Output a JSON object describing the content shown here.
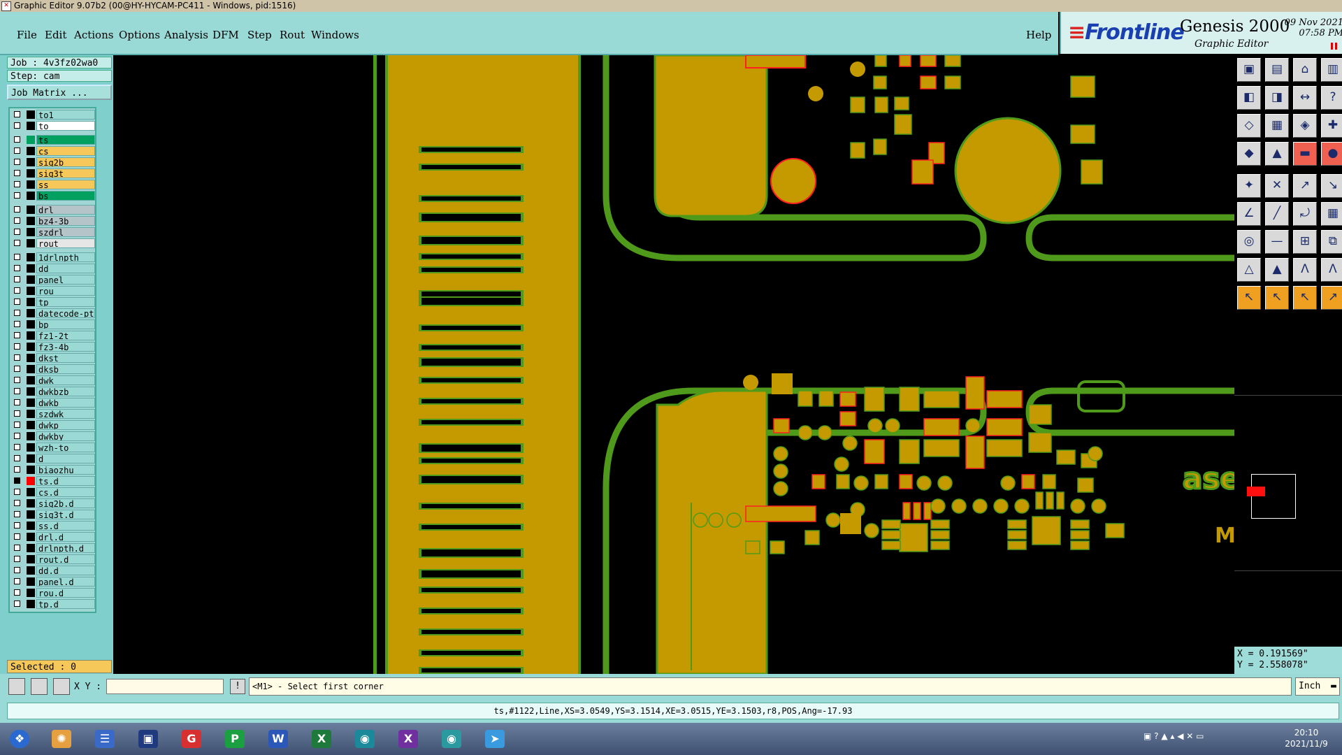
{
  "titlebar": {
    "title": "Graphic Editor 9.07b2 (00@HY-HYCAM-PC411 - Windows, pid:1516)"
  },
  "menu": {
    "items": [
      "File",
      "Edit",
      "Actions",
      "Options",
      "Analysis",
      "DFM",
      "Step",
      "Rout",
      "Windows"
    ],
    "help": "Help"
  },
  "brand": {
    "logo": "Frontline",
    "product": "Genesis 2000",
    "subtitle": "Graphic Editor",
    "date": "09 Nov 2021",
    "time": "07:58 PM"
  },
  "job": {
    "job_label": "Job : 4v3fz02wa0",
    "step_label": "Step: cam",
    "matrix_button": "Job Matrix ..."
  },
  "layers": [
    {
      "name": "to1",
      "color": "#9bd9d4",
      "sw": ""
    },
    {
      "name": "to",
      "color": "#ffffff",
      "sw": ""
    },
    {
      "name": "ts",
      "color": "#00a060",
      "sw": "#00a060",
      "active": true
    },
    {
      "name": "cs",
      "color": "#f6c85a",
      "sw": ""
    },
    {
      "name": "sig2b",
      "color": "#f6c85a",
      "sw": ""
    },
    {
      "name": "sig3t",
      "color": "#f6c85a",
      "sw": ""
    },
    {
      "name": "ss",
      "color": "#f6c85a",
      "sw": ""
    },
    {
      "name": "bs",
      "color": "#00a060",
      "sw": ""
    },
    {
      "name": "drl",
      "color": "#b4c4c8",
      "sw": ""
    },
    {
      "name": "bz4-3b",
      "color": "#b4c4c8",
      "sw": ""
    },
    {
      "name": "szdrl",
      "color": "#b4c4c8",
      "sw": ""
    },
    {
      "name": "rout",
      "color": "#e6e6e6",
      "sw": ""
    },
    {
      "name": "1drlnpth",
      "color": "#9bd9d4",
      "sw": ""
    },
    {
      "name": "dd",
      "color": "#9bd9d4",
      "sw": ""
    },
    {
      "name": "panel",
      "color": "#9bd9d4",
      "sw": ""
    },
    {
      "name": "rou",
      "color": "#9bd9d4",
      "sw": ""
    },
    {
      "name": "tp",
      "color": "#9bd9d4",
      "sw": ""
    },
    {
      "name": "datecode-pt",
      "color": "#9bd9d4",
      "sw": ""
    },
    {
      "name": "bp",
      "color": "#9bd9d4",
      "sw": ""
    },
    {
      "name": "fz1-2t",
      "color": "#9bd9d4",
      "sw": ""
    },
    {
      "name": "fz3-4b",
      "color": "#9bd9d4",
      "sw": ""
    },
    {
      "name": "dkst",
      "color": "#9bd9d4",
      "sw": ""
    },
    {
      "name": "dksb",
      "color": "#9bd9d4",
      "sw": ""
    },
    {
      "name": "dwk",
      "color": "#9bd9d4",
      "sw": ""
    },
    {
      "name": "dwkbzb",
      "color": "#9bd9d4",
      "sw": ""
    },
    {
      "name": "dwkb",
      "color": "#9bd9d4",
      "sw": ""
    },
    {
      "name": "szdwk",
      "color": "#9bd9d4",
      "sw": ""
    },
    {
      "name": "dwkp",
      "color": "#9bd9d4",
      "sw": ""
    },
    {
      "name": "dwkby",
      "color": "#9bd9d4",
      "sw": ""
    },
    {
      "name": "wzh-to",
      "color": "#9bd9d4",
      "sw": ""
    },
    {
      "name": "d",
      "color": "#9bd9d4",
      "sw": ""
    },
    {
      "name": "biaozhu",
      "color": "#9bd9d4",
      "sw": ""
    },
    {
      "name": "ts.d",
      "color": "#9bd9d4",
      "sw": "#ff0000",
      "active": true
    },
    {
      "name": "cs.d",
      "color": "#9bd9d4",
      "sw": ""
    },
    {
      "name": "sig2b.d",
      "color": "#9bd9d4",
      "sw": ""
    },
    {
      "name": "sig3t.d",
      "color": "#9bd9d4",
      "sw": ""
    },
    {
      "name": "ss.d",
      "color": "#9bd9d4",
      "sw": ""
    },
    {
      "name": "drl.d",
      "color": "#9bd9d4",
      "sw": ""
    },
    {
      "name": "drlnpth.d",
      "color": "#9bd9d4",
      "sw": ""
    },
    {
      "name": "rout.d",
      "color": "#9bd9d4",
      "sw": ""
    },
    {
      "name": "dd.d",
      "color": "#9bd9d4",
      "sw": ""
    },
    {
      "name": "panel.d",
      "color": "#9bd9d4",
      "sw": ""
    },
    {
      "name": "rou.d",
      "color": "#9bd9d4",
      "sw": ""
    },
    {
      "name": "tp.d",
      "color": "#9bd9d4",
      "sw": ""
    }
  ],
  "selected": "Selected : 0",
  "coords": {
    "x": "X = 0.191569\"",
    "y": "Y = 2.558078\""
  },
  "command": {
    "xy_label": "X Y :",
    "xy_value": "",
    "prompt": "<M1> - Select first corner",
    "units": "Inch",
    "bang": "!"
  },
  "status": "ts,#1122,Line,XS=3.0549,YS=3.1514,XE=3.0515,YE=3.1503,r8,POS,Ang=-17.93",
  "canvas_text": "ase",
  "canvas_text2": "M",
  "colors": {
    "copper": "#c49a00",
    "mask": "#4f9a1a",
    "highlight": "#ff2020",
    "panel": "#99d9d6"
  },
  "taskbar": {
    "time": "20:10",
    "date": "2021/11/9",
    "apps": [
      "start",
      "seashell",
      "notepad",
      "save",
      "genesis",
      "pdf",
      "word",
      "excel",
      "viewer",
      "xapp",
      "fish",
      "feishu"
    ]
  }
}
